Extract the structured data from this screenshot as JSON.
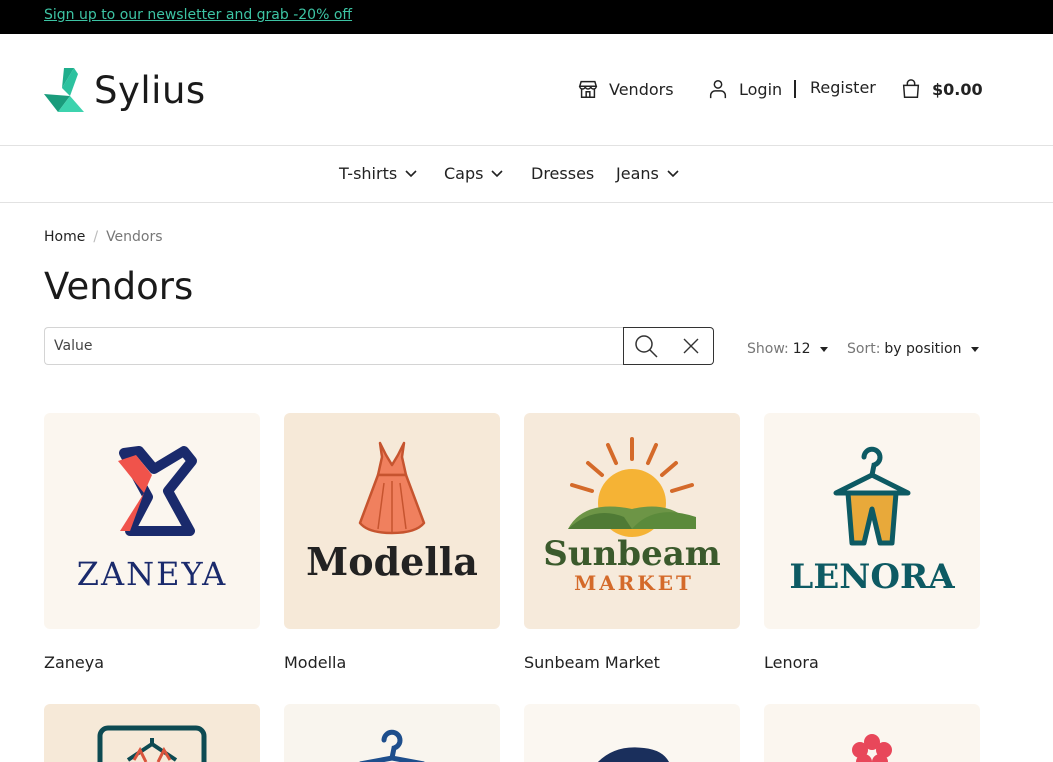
{
  "topbar": {
    "promo": "Sign up to our newsletter and grab -20% off"
  },
  "header": {
    "logo_text": "Sylius",
    "vendors": "Vendors",
    "login": "Login",
    "register": "Register",
    "cart_total": "$0.00"
  },
  "nav": {
    "items": [
      "T-shirts",
      "Caps",
      "Dresses",
      "Jeans"
    ]
  },
  "breadcrumb": {
    "home": "Home",
    "separator": "/",
    "current": "Vendors"
  },
  "page": {
    "title": "Vendors"
  },
  "search": {
    "value": "Value"
  },
  "controls": {
    "show_label": "Show:",
    "show_value": "12",
    "sort_label": "Sort:",
    "sort_value": "by position"
  },
  "vendors": [
    {
      "name": "Zaneya",
      "logo_text": "ZANEYA",
      "bg": "#fbf6ef"
    },
    {
      "name": "Modella",
      "logo_text": "Modella",
      "bg": "#f6e9d8"
    },
    {
      "name": "Sunbeam Market",
      "logo_text": "Sunbeam",
      "logo_sub": "MARKET",
      "bg": "#f6eadb"
    },
    {
      "name": "Lenora",
      "logo_text": "LENORA",
      "bg": "#fbf6ef"
    }
  ],
  "colors": {
    "accent": "#3dc4a4",
    "zaneya_navy": "#1a2a6c",
    "zaneya_red": "#f0534b",
    "modella_coral": "#f0805e",
    "sunbeam_green": "#3b5a2c",
    "sunbeam_orange": "#d46a2a",
    "lenora_teal": "#0d5a63",
    "lenora_gold": "#e8a93a"
  }
}
